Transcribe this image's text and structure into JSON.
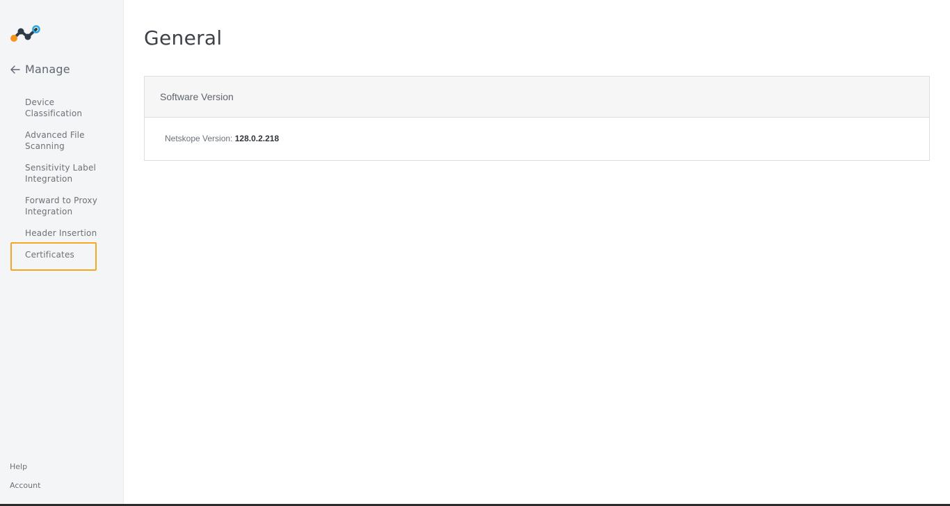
{
  "sidebar": {
    "logo_icon": "netskope-logo",
    "back_icon": "arrow-left-icon",
    "manage_label": "Manage",
    "items": [
      {
        "label_line1": "Device",
        "label_line2": "Classification"
      },
      {
        "label_line1": "Advanced File",
        "label_line2": "Scanning"
      },
      {
        "label_line1": "Sensitivity Label",
        "label_line2": "Integration"
      },
      {
        "label_line1": "Forward to Proxy",
        "label_line2": "Integration"
      },
      {
        "label_line1": "Header Insertion",
        "label_line2": ""
      },
      {
        "label_line1": "Certificates",
        "label_line2": ""
      }
    ],
    "highlighted_item": "Certificates",
    "highlight_color": "#f5a623",
    "footer": {
      "help": "Help",
      "account": "Account"
    }
  },
  "main": {
    "title": "General",
    "panel": {
      "title": "Software Version",
      "version_label": "Netskope Version: ",
      "version_value": "128.0.2.218"
    }
  },
  "colors": {
    "sidebar_bg": "#f4f5f6",
    "logo_orange": "#f7941d",
    "logo_dark": "#2e3a4a",
    "logo_blue": "#29a8e0"
  }
}
